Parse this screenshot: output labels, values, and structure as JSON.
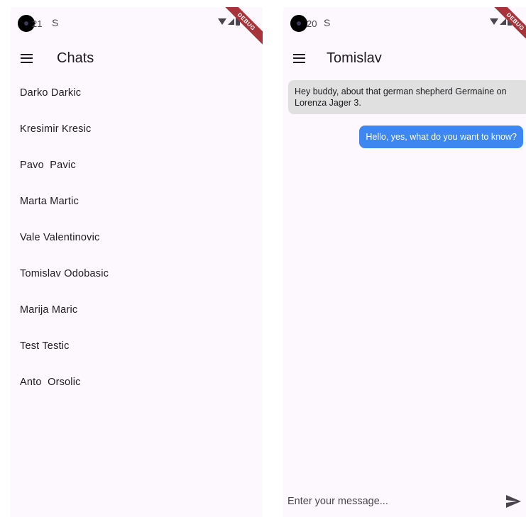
{
  "left_screen": {
    "status": {
      "time": "21",
      "glyph": "S",
      "debug_banner": "DEBUG"
    },
    "app_bar": {
      "title": "Chats",
      "menu_icon": "menu-icon"
    },
    "chats": [
      {
        "name": "Darko Darkic"
      },
      {
        "name": "Kresimir Kresic"
      },
      {
        "name": "Pavo  Pavic"
      },
      {
        "name": "Marta Martic"
      },
      {
        "name": "Vale Valentinovic"
      },
      {
        "name": "Tomislav Odobasic"
      },
      {
        "name": "Marija Maric"
      },
      {
        "name": "Test Testic"
      },
      {
        "name": "Anto  Orsolic"
      }
    ]
  },
  "right_screen": {
    "status": {
      "time": "20",
      "glyph": "S",
      "debug_banner": "DEBUG"
    },
    "app_bar": {
      "title": "Tomislav",
      "menu_icon": "menu-icon"
    },
    "messages": [
      {
        "direction": "incoming",
        "text": "Hey buddy, about that german shepherd Germaine on Lorenza Jager 3."
      },
      {
        "direction": "outgoing",
        "text": "Hello, yes, what do you want to know?"
      }
    ],
    "composer": {
      "placeholder": "Enter your message...",
      "value": "",
      "send_icon": "send-icon"
    }
  },
  "colors": {
    "background": "#fdf7fe",
    "incoming_bubble": "#e0e0e0",
    "outgoing_bubble": "#3e86f0",
    "debug_ribbon": "#a6343a"
  }
}
